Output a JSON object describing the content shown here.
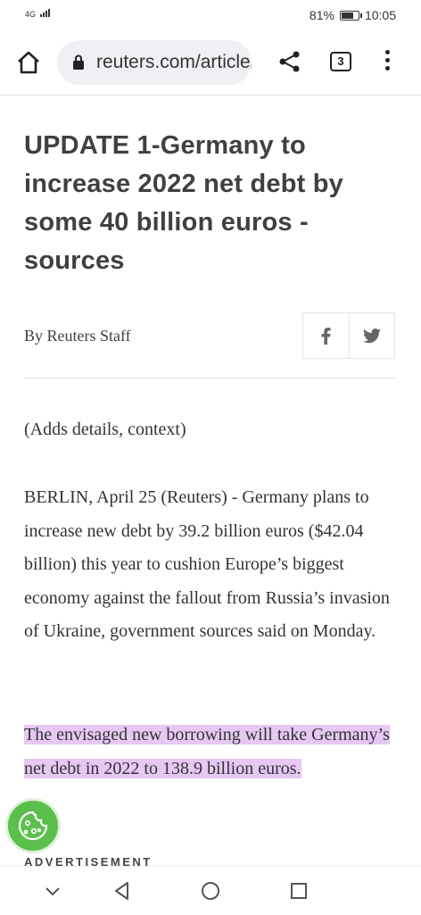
{
  "status": {
    "network": "4G",
    "battery_percent_label": "81%",
    "battery_level": 0.81,
    "time": "10:05"
  },
  "browser": {
    "url": "reuters.com/article/ukraine-crisis-germany-debt",
    "tab_count": "3",
    "icons": [
      "home-icon",
      "lock-icon",
      "share-icon",
      "tabs-icon",
      "menu-icon"
    ]
  },
  "article": {
    "headline": "UPDATE 1-Germany to increase 2022 net debt by some 40 billion euros - sources",
    "byline": "By Reuters Staff",
    "social": [
      "facebook-icon",
      "twitter-icon"
    ],
    "paragraphs": [
      "(Adds details, context)",
      "BERLIN, April 25 (Reuters) - Germany plans to increase new debt by 39.2 billion euros ($42.04 billion) this year to cushion Europe’s biggest economy against the fallout from Russia’s invasion of Ukraine, government sources said on Monday.",
      "The envisaged new borrowing will take Germany’s net debt in 2022 to 138.9 billion euros."
    ],
    "highlight_color": "#e6c8f3"
  },
  "advertisement_label": "ADVERTISEMENT",
  "cookie_button": "cookie-icon",
  "navbar": [
    "chevron-down-icon",
    "back-icon",
    "home-circle-icon",
    "recents-icon"
  ]
}
